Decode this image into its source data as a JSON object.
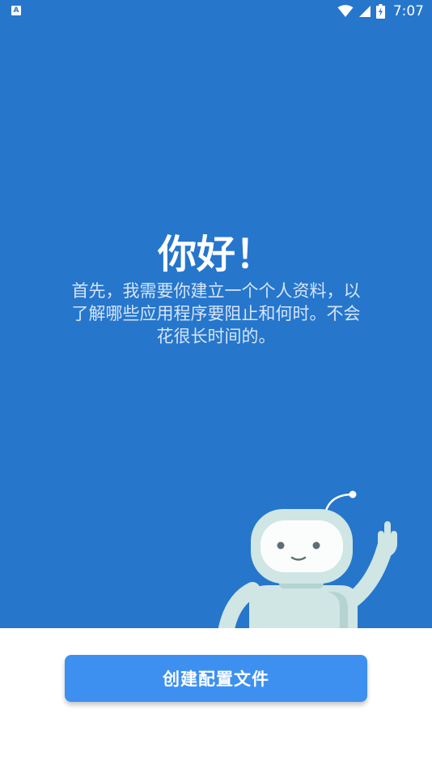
{
  "status_bar": {
    "left_icon": "A",
    "left_icon_name": "app-notification-icon",
    "wifi_icon": "wifi-icon",
    "signal_icon": "signal-icon",
    "battery_icon": "battery-charging-icon",
    "time": "7:07"
  },
  "welcome": {
    "title": "你好！",
    "message": "首先，我需要你建立一个个人资料，以了解哪些应用程序要阻止和何时。不会花很长时间的。"
  },
  "illustration": {
    "icon": "robot-waving-icon"
  },
  "actions": {
    "create_profile_label": "创建配置文件"
  },
  "colors": {
    "hero_background": "#2676cc",
    "button_background": "#3d90f0",
    "robot_body": "#cfe6e4"
  }
}
